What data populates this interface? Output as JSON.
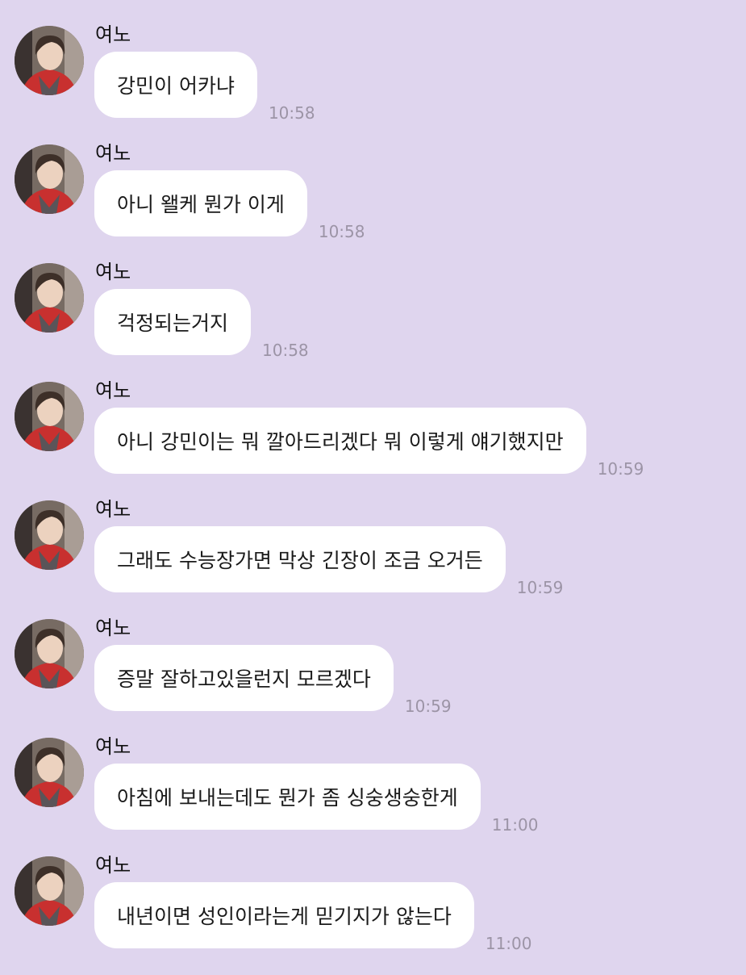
{
  "messages": [
    {
      "sender": "여노",
      "text": "강민이 어카냐",
      "time": "10:58"
    },
    {
      "sender": "여노",
      "text": "아니 왤케 뭔가 이게",
      "time": "10:58"
    },
    {
      "sender": "여노",
      "text": "걱정되는거지",
      "time": "10:58"
    },
    {
      "sender": "여노",
      "text": "아니 강민이는 뭐 깔아드리겠다 뭐 이렇게 얘기했지만",
      "time": "10:59"
    },
    {
      "sender": "여노",
      "text": "그래도 수능장가면 막상 긴장이 조금 오거든",
      "time": "10:59"
    },
    {
      "sender": "여노",
      "text": "증말 잘하고있을런지 모르겠다",
      "time": "10:59"
    },
    {
      "sender": "여노",
      "text": "아침에 보내는데도 뭔가 좀 싱숭생숭한게",
      "time": "11:00"
    },
    {
      "sender": "여노",
      "text": "내년이면 성인이라는게 믿기지가 않는다",
      "time": "11:00"
    }
  ],
  "colors": {
    "background": "#dfd5ee",
    "bubble": "#ffffff",
    "time": "#9c94a6"
  },
  "icons": {
    "avatar": "profile-photo"
  }
}
